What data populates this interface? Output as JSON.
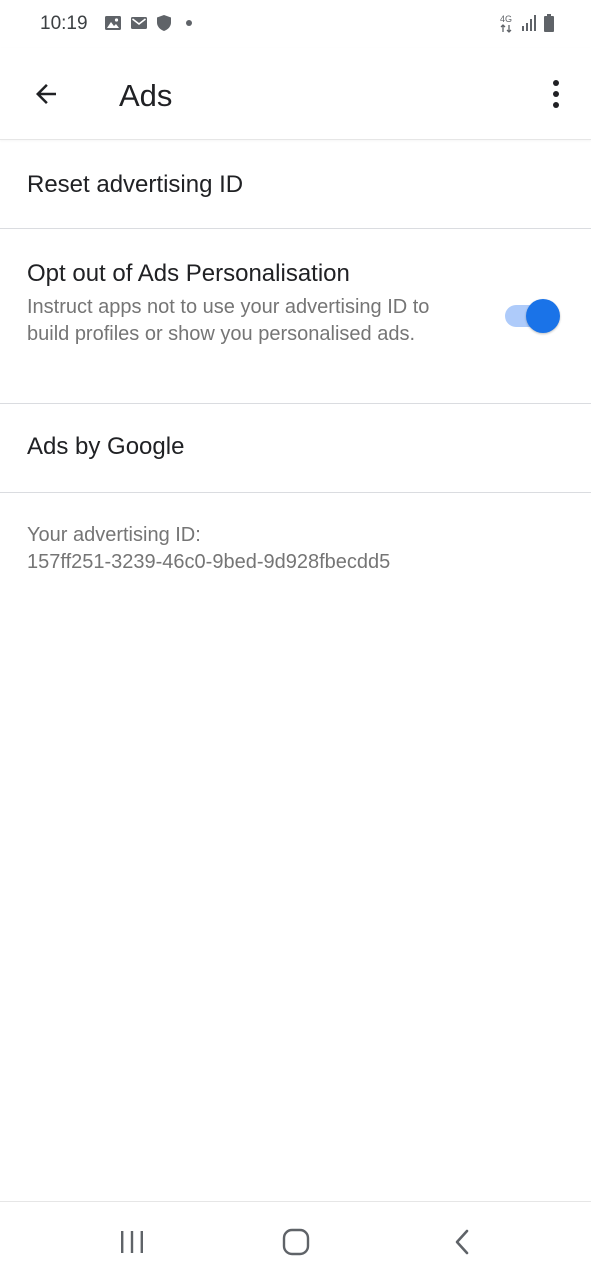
{
  "status_bar": {
    "time": "10:19",
    "left_icons": [
      "image-icon",
      "mail-icon",
      "shield-icon"
    ],
    "right_icons": [
      "4g-icon",
      "signal-icon",
      "battery-icon"
    ],
    "network_label": "4G"
  },
  "app_bar": {
    "title": "Ads",
    "back_icon": "arrow-back-icon",
    "overflow_icon": "more-vert-icon"
  },
  "rows": [
    {
      "title": "Reset advertising ID"
    },
    {
      "title": "Opt out of Ads Personalisation",
      "summary": "Instruct apps not to use your advertising ID to build profiles or show you personalised ads.",
      "toggle_on": true
    },
    {
      "title": "Ads by Google"
    }
  ],
  "advertising_id": {
    "label": "Your advertising ID:",
    "value": "157ff251-3239-46c0-9bed-9d928fbecdd5"
  },
  "nav_bar": {
    "recents_icon": "recents-icon",
    "home_icon": "home-icon",
    "back_icon": "nav-back-icon"
  },
  "colors": {
    "accent": "#1a73e8",
    "track": "#aecbfa",
    "divider": "#dadce0",
    "secondary_text": "#757575"
  }
}
